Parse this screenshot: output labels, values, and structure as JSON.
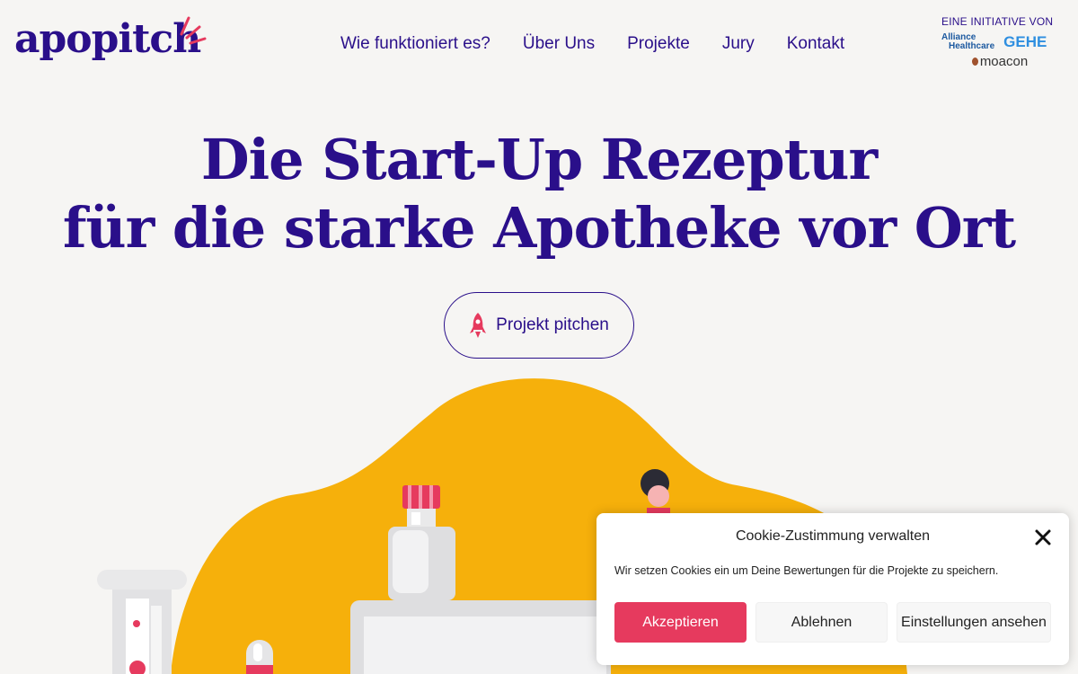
{
  "header": {
    "logo_text": "apopitch",
    "nav": [
      "Wie funktioniert es?",
      "Über Uns",
      "Projekte",
      "Jury",
      "Kontakt"
    ],
    "initiative_label": "EINE INITIATIVE VON",
    "partners": {
      "alliance_line1": "Alliance",
      "alliance_line2": "Healthcare",
      "gehe": "GEHE",
      "moacon": "moacon"
    }
  },
  "hero": {
    "title_line1": "Die Start-Up Rezeptur",
    "title_line2": "für die starke Apotheke vor Ort",
    "cta_label": "Projekt pitchen",
    "cta_icon": "rocket-icon"
  },
  "cookie": {
    "title": "Cookie-Zustimmung verwalten",
    "text": "Wir setzen Cookies ein um Deine Bewertungen für die Projekte zu speichern.",
    "accept": "Akzeptieren",
    "deny": "Ablehnen",
    "settings": "Einstellungen ansehen",
    "close_icon": "close-icon"
  },
  "colors": {
    "brand": "#2a0f8a",
    "accent": "#e63a5e",
    "blob": "#f6b00b",
    "background": "#f6f5f3"
  }
}
